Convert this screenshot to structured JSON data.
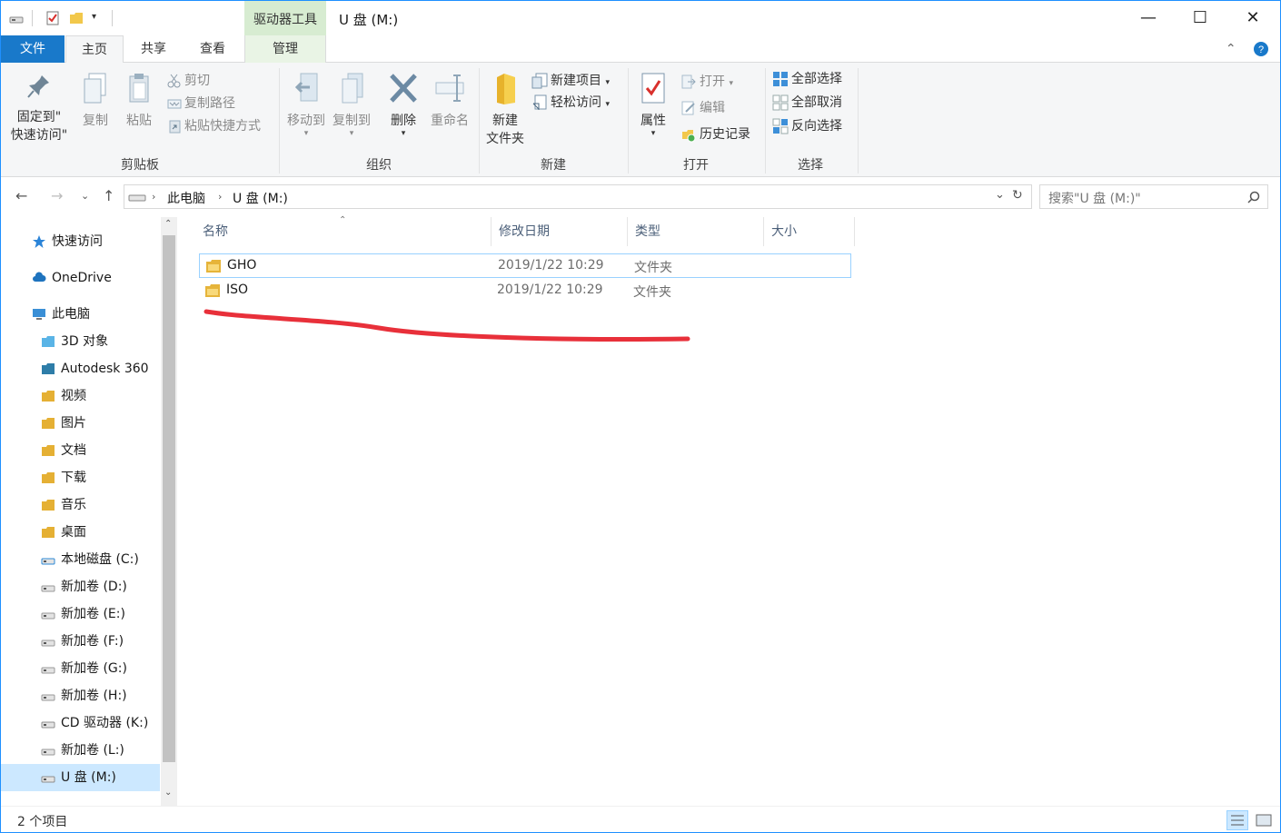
{
  "window": {
    "title": "U 盘 (M:)",
    "context_tab_group": "驱动器工具",
    "controls": {
      "minimize": "—",
      "maximize": "☐",
      "close": "✕"
    }
  },
  "ribbon_tabs": [
    {
      "label": "文件"
    },
    {
      "label": "主页"
    },
    {
      "label": "共享"
    },
    {
      "label": "查看"
    },
    {
      "label": "管理"
    }
  ],
  "ribbon": {
    "clipboard": {
      "label": "剪贴板",
      "pin_line1": "固定到\"",
      "pin_line2": "快速访问\"",
      "copy": "复制",
      "paste": "粘贴",
      "cut": "剪切",
      "copy_path": "复制路径",
      "paste_shortcut": "粘贴快捷方式"
    },
    "organize": {
      "label": "组织",
      "move_to": "移动到",
      "copy_to": "复制到",
      "delete": "删除",
      "rename": "重命名"
    },
    "new": {
      "label": "新建",
      "new_folder_line1": "新建",
      "new_folder_line2": "文件夹",
      "new_item": "新建项目",
      "easy_access": "轻松访问"
    },
    "open": {
      "label": "打开",
      "properties": "属性",
      "open": "打开",
      "edit": "编辑",
      "history": "历史记录"
    },
    "select": {
      "label": "选择",
      "select_all": "全部选择",
      "select_none": "全部取消",
      "invert": "反向选择"
    }
  },
  "address": {
    "crumbs": [
      "此电脑",
      "U 盘 (M:)"
    ],
    "search_placeholder": "搜索\"U 盘 (M:)\""
  },
  "nav_pane": {
    "items": [
      {
        "label": "快速访问",
        "icon": "star-icon"
      },
      {
        "label": "OneDrive",
        "icon": "cloud-icon"
      },
      {
        "label": "此电脑",
        "icon": "computer-icon"
      },
      {
        "label": "3D 对象",
        "icon": "3d-objects-icon"
      },
      {
        "label": "Autodesk 360",
        "icon": "autodesk-icon"
      },
      {
        "label": "视频",
        "icon": "video-folder-icon"
      },
      {
        "label": "图片",
        "icon": "pictures-folder-icon"
      },
      {
        "label": "文档",
        "icon": "documents-folder-icon"
      },
      {
        "label": "下载",
        "icon": "downloads-folder-icon"
      },
      {
        "label": "音乐",
        "icon": "music-folder-icon"
      },
      {
        "label": "桌面",
        "icon": "desktop-folder-icon"
      },
      {
        "label": "本地磁盘 (C:)",
        "icon": "windows-drive-icon"
      },
      {
        "label": "新加卷 (D:)",
        "icon": "drive-icon"
      },
      {
        "label": "新加卷 (E:)",
        "icon": "drive-icon"
      },
      {
        "label": "新加卷 (F:)",
        "icon": "drive-icon"
      },
      {
        "label": "新加卷 (G:)",
        "icon": "drive-icon"
      },
      {
        "label": "新加卷 (H:)",
        "icon": "drive-icon"
      },
      {
        "label": "CD 驱动器 (K:)",
        "icon": "cd-drive-icon"
      },
      {
        "label": "新加卷 (L:)",
        "icon": "drive-icon"
      },
      {
        "label": "U 盘 (M:)",
        "icon": "usb-drive-icon"
      }
    ]
  },
  "columns": {
    "name": "名称",
    "date": "修改日期",
    "type": "类型",
    "size": "大小"
  },
  "files": [
    {
      "name": "GHO",
      "date": "2019/1/22 10:29",
      "type": "文件夹",
      "size": ""
    },
    {
      "name": "ISO",
      "date": "2019/1/22 10:29",
      "type": "文件夹",
      "size": ""
    }
  ],
  "status": {
    "item_count": "2 个项目"
  },
  "colors": {
    "accent": "#1979ca",
    "selection": "#cce8ff",
    "annotation": "#e8303a"
  }
}
